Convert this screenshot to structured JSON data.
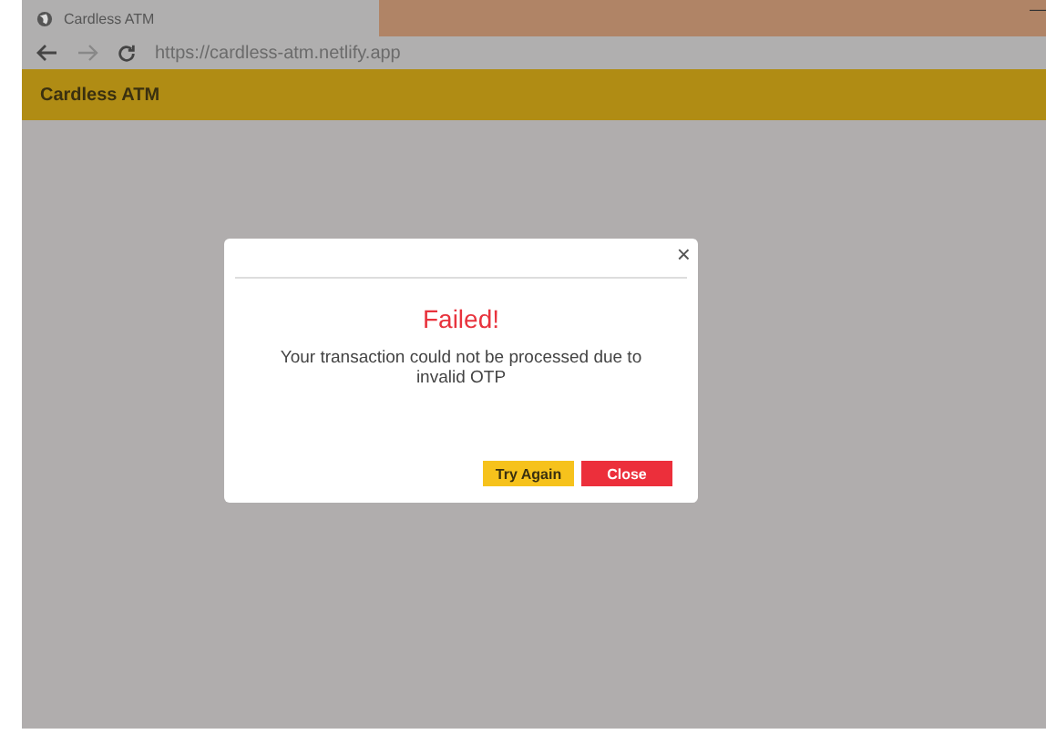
{
  "browser": {
    "tab_title": "Cardless ATM",
    "url": "https://cardless-atm.netlify.app",
    "minimize": "—"
  },
  "app_bar": {
    "title": "Cardless ATM"
  },
  "dialog": {
    "close": "×",
    "heading": "Failed!",
    "message": "Your transaction could not be processed due to invalid OTP",
    "buttons": [
      {
        "label": "Try Again",
        "kind": "secondary"
      },
      {
        "label": "Close",
        "kind": "danger"
      }
    ]
  }
}
